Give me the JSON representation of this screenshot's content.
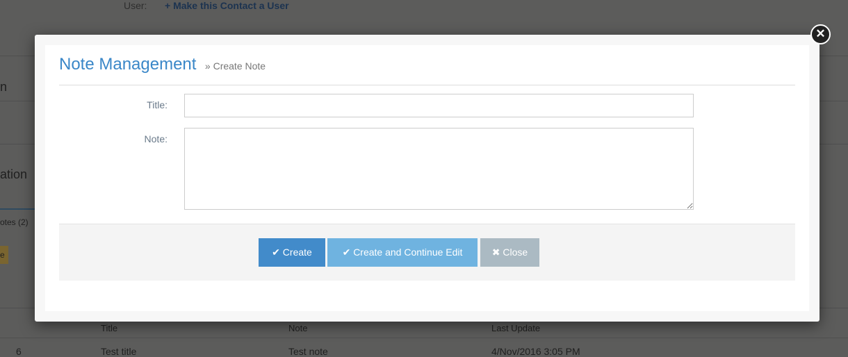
{
  "background": {
    "user_label": "User:",
    "make_user_link": "+ Make this Contact a User",
    "section1_fragment": "n",
    "section2_fragment": "ation",
    "notes_tab": "otes (2)",
    "yellow_button_fragment": "e",
    "table": {
      "headers": [
        "Title",
        "Note",
        "Last Update"
      ],
      "rows": [
        {
          "id": "6",
          "title": "Test title",
          "note": "Test note",
          "updated": "4/Nov/2016 3:05 PM"
        }
      ]
    }
  },
  "modal": {
    "title": "Note Management",
    "breadcrumb": "» Create Note",
    "fields": {
      "title_label": "Title:",
      "title_value": "",
      "note_label": "Note:",
      "note_value": ""
    },
    "buttons": {
      "create": "✔ Create",
      "create_continue": "✔ Create and Continue Edit",
      "close": "✖ Close"
    },
    "colors": {
      "create": "#428bca",
      "create_continue": "#6fb3e0",
      "close": "#abbac3"
    },
    "close_icon": "close-circle-icon"
  }
}
